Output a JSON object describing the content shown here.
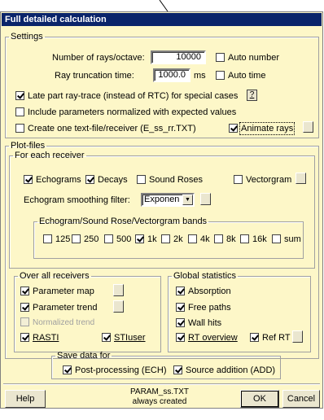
{
  "window": {
    "title": "Full detailed calculation"
  },
  "settings": {
    "legend": "Settings",
    "rays_label": "Number of rays/octave:",
    "rays_value": "10000",
    "auto_number": {
      "label": "Auto number",
      "checked": false
    },
    "trunc_label": "Ray truncation time:",
    "trunc_value": "1000.0",
    "trunc_unit": "ms",
    "auto_time": {
      "label": "Auto time",
      "checked": false
    },
    "late_part": {
      "label": "Late part ray-trace (instead of RTC) for special cases",
      "checked": true
    },
    "help_q": "?",
    "include_norm": {
      "label": "Include parameters normalized with expected values",
      "checked": false
    },
    "create_file": {
      "label": "Create one text-file/receiver (E_ss_rr.TXT)",
      "checked": false
    },
    "animate": {
      "label": "Animate rays",
      "checked": true
    }
  },
  "plotfiles": {
    "legend": "Plot-files",
    "each_receiver": {
      "legend": "For each receiver",
      "echograms": {
        "label": "Echograms",
        "checked": true
      },
      "decays": {
        "label": "Decays",
        "checked": true
      },
      "sound_roses": {
        "label": "Sound Roses",
        "checked": false
      },
      "vectorgram": {
        "label": "Vectorgram",
        "checked": false
      },
      "smoothing_label": "Echogram smoothing filter:",
      "smoothing_value": "Exponen",
      "bands": {
        "legend": "Echogram/Sound Rose/Vectorgram bands",
        "items": [
          {
            "label": "125",
            "checked": false
          },
          {
            "label": "250",
            "checked": false
          },
          {
            "label": "500",
            "checked": false
          },
          {
            "label": "1k",
            "checked": true
          },
          {
            "label": "2k",
            "checked": false
          },
          {
            "label": "4k",
            "checked": false
          },
          {
            "label": "8k",
            "checked": false
          },
          {
            "label": "16k",
            "checked": false
          },
          {
            "label": "sum",
            "checked": false
          }
        ]
      }
    },
    "over_all": {
      "legend": "Over all receivers",
      "param_map": {
        "label": "Parameter map",
        "checked": true
      },
      "param_trend": {
        "label": "Parameter trend",
        "checked": true
      },
      "norm_trend": {
        "label": "Normalized trend",
        "checked": false,
        "disabled": true
      },
      "rasti": {
        "label": "RASTI",
        "checked": true
      },
      "stiuser": {
        "label": "STIuser",
        "checked": true
      }
    },
    "global_stats": {
      "legend": "Global statistics",
      "absorption": {
        "label": "Absorption",
        "checked": true
      },
      "free_paths": {
        "label": "Free paths",
        "checked": true
      },
      "wall_hits": {
        "label": "Wall hits",
        "checked": true
      },
      "rt_overview": {
        "label": "RT overview",
        "checked": true
      },
      "ref_rt": {
        "label": "Ref RT",
        "checked": true
      }
    }
  },
  "save": {
    "legend": "Save data for",
    "postproc": {
      "label": "Post-processing (ECH)",
      "checked": true
    },
    "source_add": {
      "label": "Source addition (ADD)",
      "checked": true
    }
  },
  "footer": {
    "help": "Help",
    "note_line1": "PARAM_ss.TXT",
    "note_line2": "always created",
    "ok": "OK",
    "cancel": "Cancel"
  }
}
